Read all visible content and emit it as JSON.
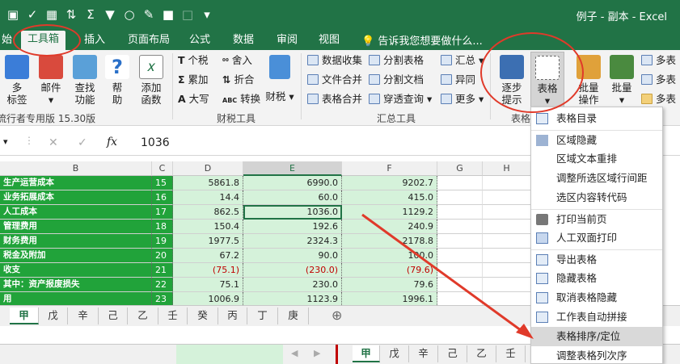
{
  "title_bar": {
    "title": "例子 - 副本 - Excel"
  },
  "qat_icons": [
    "save-icon",
    "check-icon",
    "grid-icon",
    "sort-icon",
    "sum-icon",
    "filter-icon",
    "circle-icon",
    "brush-icon",
    "fill-icon",
    "blank-icon",
    "dropdown-icon"
  ],
  "tabs": [
    {
      "label": "始"
    },
    {
      "label": "工具箱"
    },
    {
      "label": "插入"
    },
    {
      "label": "页面布局"
    },
    {
      "label": "公式"
    },
    {
      "label": "数据"
    },
    {
      "label": "审阅"
    },
    {
      "label": "视图"
    }
  ],
  "tell_me": "告诉我您想要做什么...",
  "ribbon": {
    "big_buttons": [
      {
        "label1": "多",
        "label2": "标签"
      },
      {
        "label1": "邮件",
        "label2": "▾"
      },
      {
        "label1": "查找",
        "label2": "功能"
      },
      {
        "label1": "帮",
        "label2": "助"
      },
      {
        "label1": "添加",
        "label2": "函数"
      }
    ],
    "left_group_label": "流行者专用版 15.30版",
    "tax_buttons": [
      {
        "icon": "T",
        "label": "个税"
      },
      {
        "icon": "Σ",
        "label": "累加"
      },
      {
        "icon": "A",
        "label": "大写"
      },
      {
        "icon": "⁰⁰",
        "label": "舍入"
      },
      {
        "icon": "⇅",
        "label": "折合"
      },
      {
        "icon": "ABC",
        "label": "转换"
      }
    ],
    "finance_label": "财税 ▾",
    "tax_group_label": "财税工具",
    "summary_buttons": [
      {
        "label": "数据收集"
      },
      {
        "label": "文件合并"
      },
      {
        "label": "表格合并"
      },
      {
        "label": "分割表格"
      },
      {
        "label": "分割文档"
      },
      {
        "label": "穿透查询 ▾"
      },
      {
        "label": "汇总 ▾"
      },
      {
        "label": "异同"
      },
      {
        "label": "更多 ▾"
      }
    ],
    "summary_group_label": "汇总工具",
    "step_button": {
      "label1": "逐步",
      "label2": "提示"
    },
    "table_button": {
      "label1": "表格",
      "label2": "▾"
    },
    "table_group_label": "表格",
    "batch_op": {
      "label1": "批量",
      "label2": "操作"
    },
    "batch": {
      "label1": "批量",
      "label2": "▾"
    },
    "more_items": [
      {
        "label": "多表"
      },
      {
        "label": "多表"
      },
      {
        "label": "多表"
      }
    ]
  },
  "formula_bar": {
    "fx": "fx",
    "value": "1036"
  },
  "columns": [
    "B",
    "C",
    "D",
    "E",
    "F",
    "G",
    "H"
  ],
  "rows": [
    {
      "name": "生产运营成本",
      "num": "15",
      "d": "5861.8",
      "e": "6990.0",
      "f": "9202.7"
    },
    {
      "name": "业务拓展成本",
      "num": "16",
      "d": "14.4",
      "e": "60.0",
      "f": "415.0"
    },
    {
      "name": "人工成本",
      "num": "17",
      "d": "862.5",
      "e": "1036.0",
      "f": "1129.2"
    },
    {
      "name": "管理费用",
      "num": "18",
      "d": "150.4",
      "e": "192.6",
      "f": "240.9"
    },
    {
      "name": "财务费用",
      "num": "19",
      "d": "1977.5",
      "e": "2324.3",
      "f": "2178.8"
    },
    {
      "name": "税金及附加",
      "num": "20",
      "d": "67.2",
      "e": "90.0",
      "f": "100.0"
    },
    {
      "name": "收支",
      "num": "21",
      "d": "(75.1)",
      "e": "(230.0)",
      "f": "(79.6)"
    },
    {
      "name": "其中：资产报废损失",
      "num": "22",
      "d": "75.1",
      "e": "230.0",
      "f": "79.6"
    },
    {
      "name": "用",
      "num": "23",
      "d": "1006.9",
      "e": "1123.9",
      "f": "1996.1"
    }
  ],
  "sheet_tabs": [
    "甲",
    "戊",
    "辛",
    "己",
    "乙",
    "壬",
    "癸",
    "丙",
    "丁",
    "庚"
  ],
  "lower_tabs": [
    "甲",
    "戊",
    "辛",
    "己",
    "乙",
    "壬"
  ],
  "dropdown_menu": [
    {
      "label": "表格目录"
    },
    {
      "label": "区域隐藏"
    },
    {
      "label": "区域文本重排"
    },
    {
      "label": "调整所选区域行间距"
    },
    {
      "label": "选区内容转代码"
    },
    {
      "label": "打印当前页"
    },
    {
      "label": "人工双面打印"
    },
    {
      "label": "导出表格"
    },
    {
      "label": "隐藏表格"
    },
    {
      "label": "取消表格隐藏"
    },
    {
      "label": "工作表自动拼接"
    },
    {
      "label": "表格排序/定位"
    },
    {
      "label": "调整表格列次序"
    }
  ],
  "colors": {
    "excel_green": "#217346",
    "cell_fill": "#d5f2da",
    "label_green": "#21a33a",
    "annotation_red": "#e03a2a",
    "negative": "#c00000"
  }
}
